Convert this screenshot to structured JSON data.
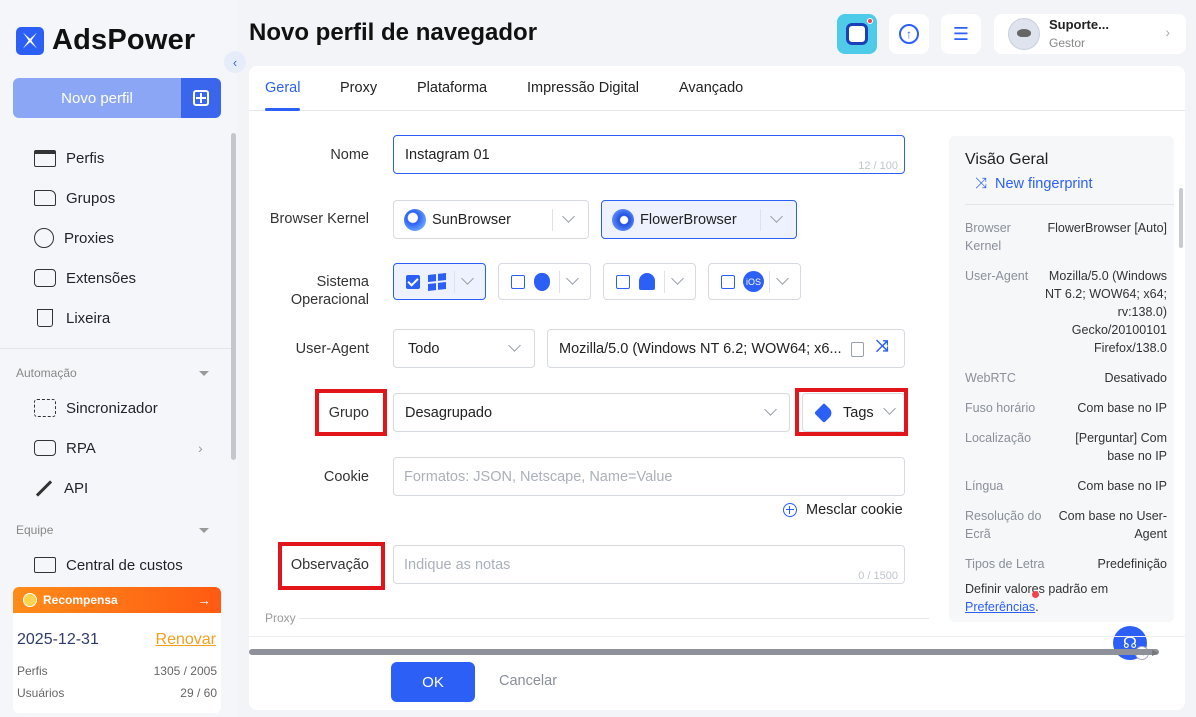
{
  "app": {
    "name": "AdsPower"
  },
  "sidebar": {
    "new_profile_label": "Novo perfil",
    "items": [
      {
        "label": "Perfis",
        "icon": "window-icon"
      },
      {
        "label": "Grupos",
        "icon": "folder-icon"
      },
      {
        "label": "Proxies",
        "icon": "globe-icon"
      },
      {
        "label": "Extensões",
        "icon": "puzzle-icon"
      },
      {
        "label": "Lixeira",
        "icon": "trash-icon"
      }
    ],
    "automation_label": "Automação",
    "automation_items": [
      {
        "label": "Sincronizador",
        "icon": "sync-icon"
      },
      {
        "label": "RPA",
        "icon": "robot-icon"
      },
      {
        "label": "API",
        "icon": "plug-icon"
      }
    ],
    "team_label": "Equipe",
    "team_items": [
      {
        "label": "Central de custos",
        "icon": "cost-icon"
      }
    ],
    "reward": {
      "title": "Recompensa",
      "date": "2025-12-31",
      "renew": "Renovar",
      "profiles_label": "Perfis",
      "profiles_value": "1305 / 2005",
      "users_label": "Usuários",
      "users_value": "29 / 60"
    }
  },
  "header": {
    "title": "Novo perfil de navegador",
    "user_name": "Suporte...",
    "user_role": "Gestor"
  },
  "tabs": [
    {
      "label": "Geral",
      "active": true
    },
    {
      "label": "Proxy"
    },
    {
      "label": "Plataforma"
    },
    {
      "label": "Impressão Digital"
    },
    {
      "label": "Avançado"
    }
  ],
  "form": {
    "name_label": "Nome",
    "name_value": "Instagram 01",
    "name_counter": "12 / 100",
    "kernel_label": "Browser Kernel",
    "kernel_options": [
      "SunBrowser",
      "FlowerBrowser"
    ],
    "kernel_selected": "FlowerBrowser",
    "os_label_line1": "Sistema",
    "os_label_line2": "Operacional",
    "os_options": [
      {
        "name": "Windows",
        "icon": "windows-icon",
        "checked": true
      },
      {
        "name": "macOS",
        "icon": "apple-icon",
        "checked": false
      },
      {
        "name": "Android",
        "icon": "android-icon",
        "checked": false
      },
      {
        "name": "iOS",
        "icon": "ios-icon",
        "checked": false
      }
    ],
    "ios_text": "iOS",
    "ua_label": "User-Agent",
    "ua_filter": "Todo",
    "ua_value": "Mozilla/5.0 (Windows NT 6.2; WOW64; x6...",
    "group_label": "Grupo",
    "group_value": "Desagrupado",
    "tags_label": "Tags",
    "cookie_label": "Cookie",
    "cookie_placeholder": "Formatos: JSON, Netscape, Name=Value",
    "merge_cookie": "Mesclar cookie",
    "note_label": "Observação",
    "note_placeholder": "Indique as notas",
    "note_counter": "0 / 1500",
    "proxy_section": "Proxy"
  },
  "overview": {
    "title": "Visão Geral",
    "new_fingerprint": "New fingerprint",
    "rows": [
      {
        "key": "Browser Kernel",
        "value": "FlowerBrowser [Auto]"
      },
      {
        "key": "User-Agent",
        "value": "Mozilla/5.0 (Windows NT 6.2; WOW64; x64; rv:138.0) Gecko/20100101 Firefox/138.0"
      },
      {
        "key": "WebRTC",
        "value": "Desativado"
      },
      {
        "key": "Fuso horário",
        "value": "Com base no IP"
      },
      {
        "key": "Localização",
        "value": "[Perguntar] Com base no IP"
      },
      {
        "key": "Língua",
        "value": "Com base no IP"
      },
      {
        "key": "Resolução do Ecrã",
        "value": "Com base no User-Agent"
      },
      {
        "key": "Tipos de Letra",
        "value": "Predefinição"
      }
    ],
    "footer_text": "Definir valores padrão em",
    "footer_link": "Preferências",
    "footer_end": "."
  },
  "footer": {
    "ok": "OK",
    "cancel": "Cancelar"
  },
  "colors": {
    "accent": "#2c5ff6",
    "highlight": "#e1151a",
    "reward": "#ff6a13"
  }
}
